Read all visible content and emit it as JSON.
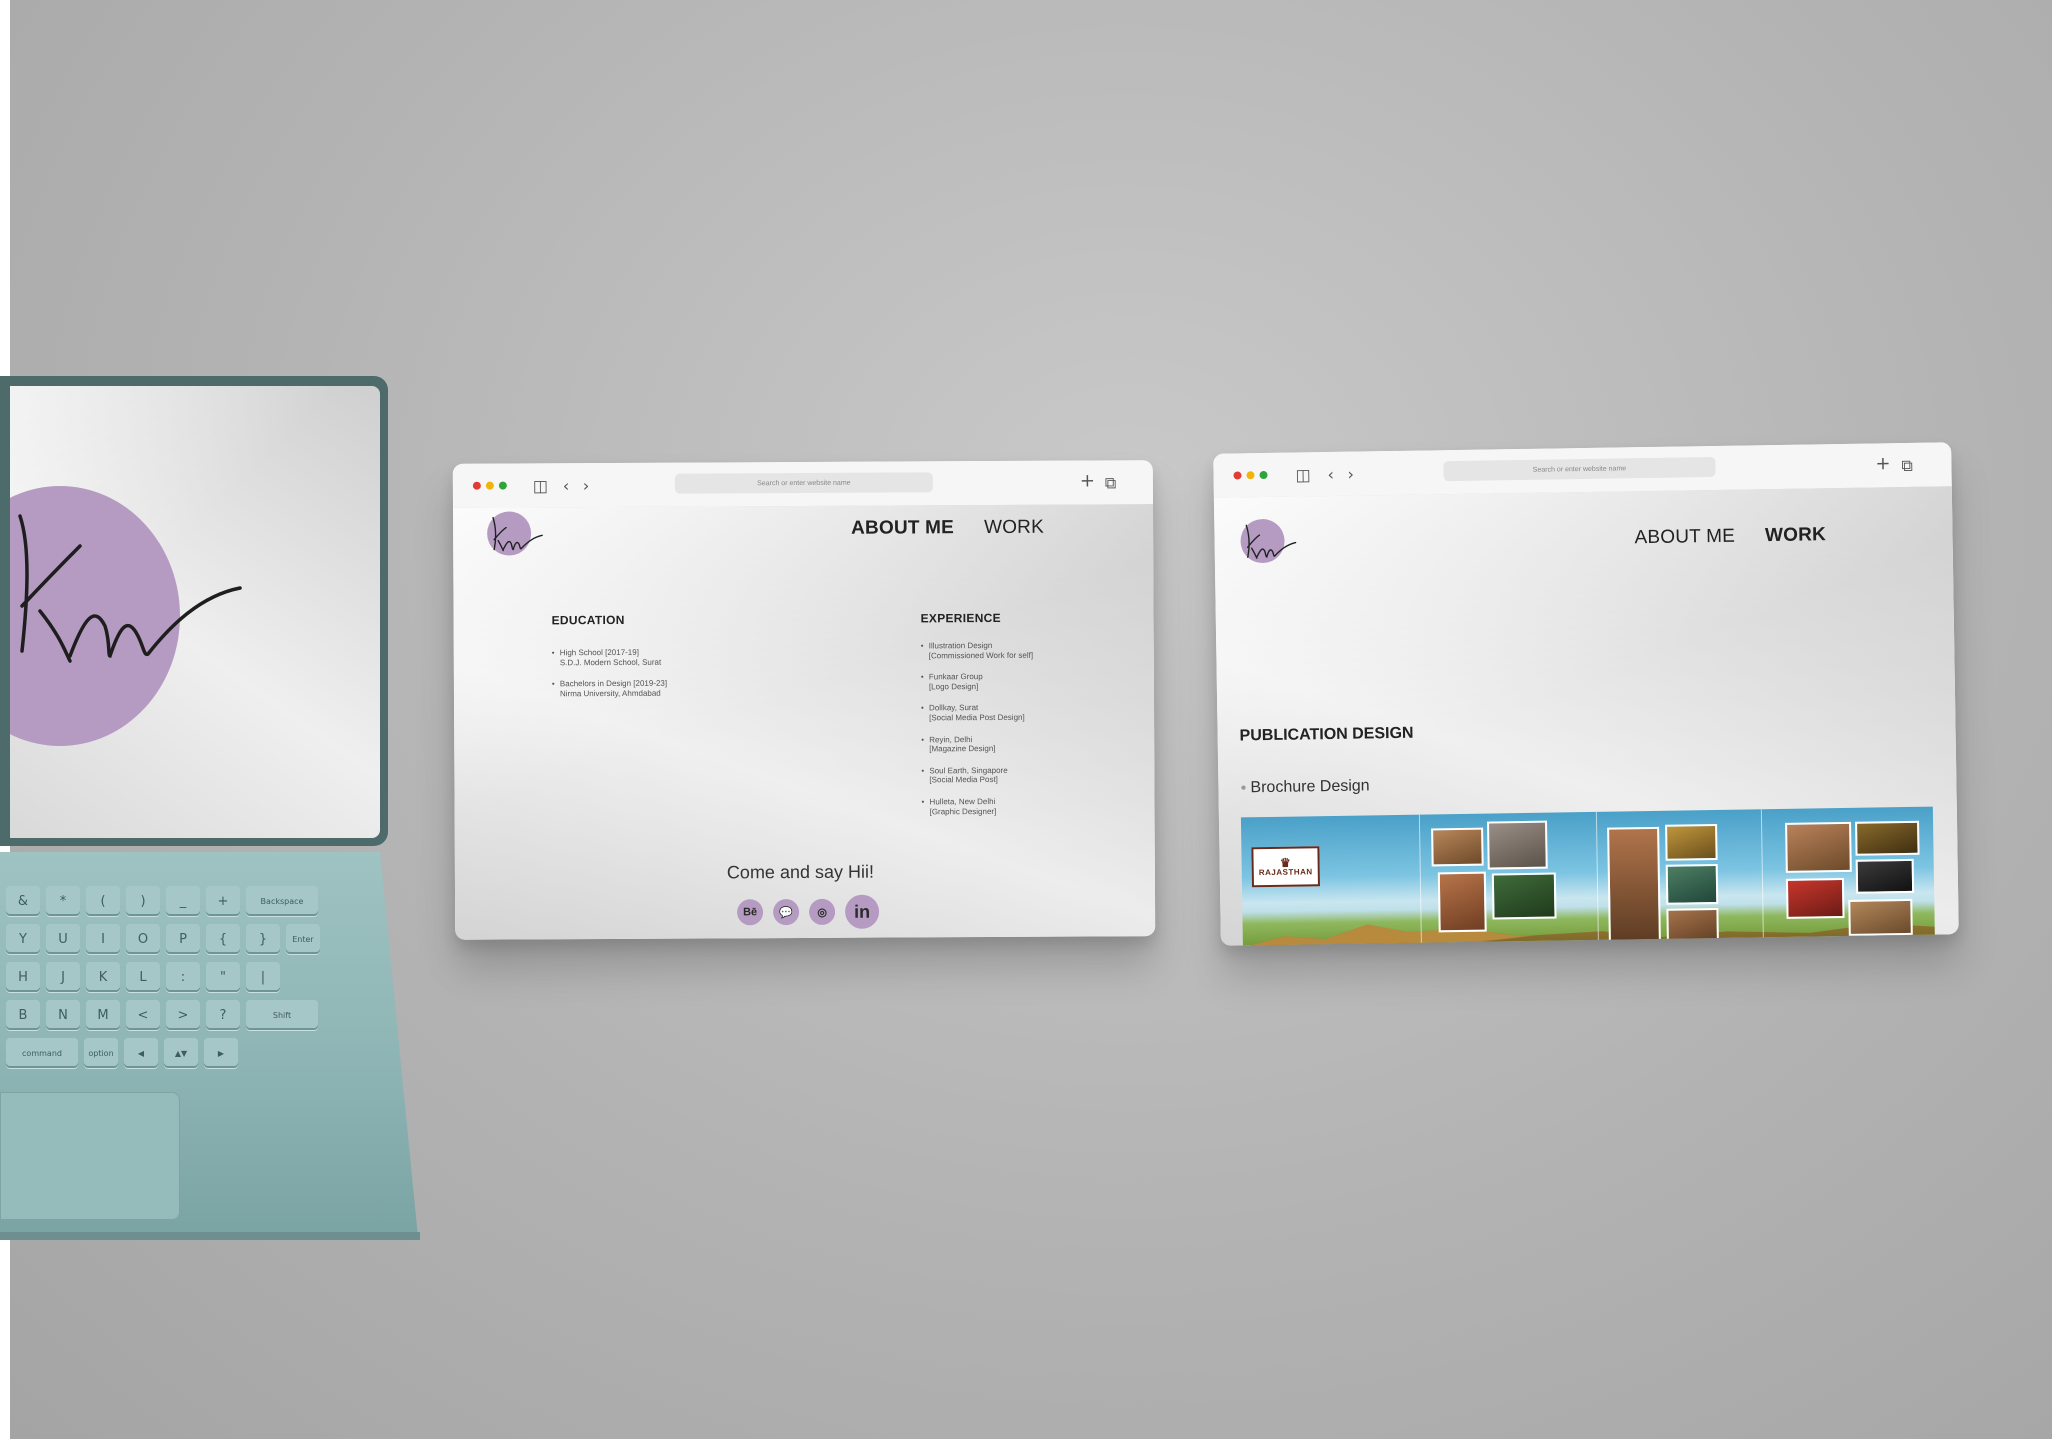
{
  "colors": {
    "accent": "#b59bc2",
    "laptop_body": "#8cb3b3",
    "backdrop": "#b3b3b3"
  },
  "laptop": {
    "keyboard_rows": [
      [
        "&",
        "*",
        "(",
        ")",
        "_",
        "+",
        "Backspace"
      ],
      [
        "Y",
        "U",
        "I",
        "O",
        "P",
        "{",
        "}",
        "Enter"
      ],
      [
        "H",
        "J",
        "K",
        "L",
        ":",
        "\"",
        "|"
      ],
      [
        "B",
        "N",
        "M",
        "<",
        ">",
        "?",
        "Shift"
      ],
      [
        "command",
        "option",
        "◀",
        "▲▼",
        "▶"
      ]
    ]
  },
  "browser_about": {
    "url_placeholder": "Search or enter website name",
    "nav": {
      "about": "ABOUT ME",
      "work": "WORK"
    },
    "education_title": "EDUCATION",
    "education": [
      {
        "line1": "High School [2017-19]",
        "line2": "S.D.J. Modern School, Surat"
      },
      {
        "line1": "Bachelors in Design [2019-23]",
        "line2": "Nirma University, Ahmdabad"
      }
    ],
    "experience_title": "EXPERIENCE",
    "experience": [
      {
        "line1": "Illustration Design",
        "line2": "[Commissioned Work for self]"
      },
      {
        "line1": "Funkaar Group",
        "line2": "[Logo Design]"
      },
      {
        "line1": "Dollkay, Surat",
        "line2": "[Social Media Post Design]"
      },
      {
        "line1": "Reyin, Delhi",
        "line2": "[Magazine Design]"
      },
      {
        "line1": "Soul Earth, Singapore",
        "line2": "[Social Media Post]"
      },
      {
        "line1": "Hulleta, New Delhi",
        "line2": "[Graphic Designer]"
      }
    ],
    "cta": "Come and say Hii!",
    "socials": [
      "Bē",
      "💬",
      "◎",
      "in"
    ]
  },
  "browser_work": {
    "url_placeholder": "Search or enter website name",
    "nav": {
      "about": "ABOUT ME",
      "work": "WORK"
    },
    "section_title": "PUBLICATION DESIGN",
    "item": "Brochure Design",
    "brochure_badge": "RAJASTHAN"
  }
}
